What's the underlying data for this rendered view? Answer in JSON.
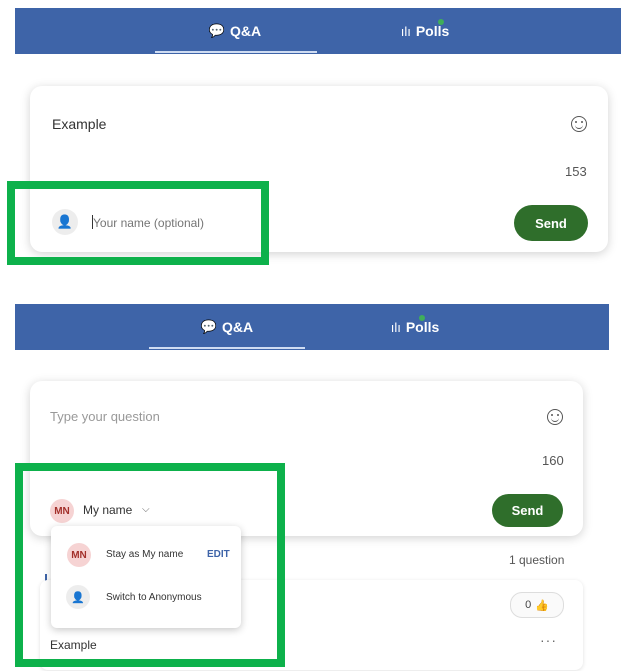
{
  "panel1": {
    "tabs": [
      {
        "label": "Q&A",
        "icon": "chat-bubbles-icon"
      },
      {
        "label": "Polls",
        "icon": "bar-chart-icon"
      }
    ],
    "question_text": "Example",
    "char_counter": "153",
    "name_placeholder": "Your name (optional)",
    "send_label": "Send"
  },
  "panel2": {
    "tabs": [
      {
        "label": "Q&A",
        "icon": "chat-bubbles-icon"
      },
      {
        "label": "Polls",
        "icon": "bar-chart-icon"
      }
    ],
    "question_placeholder": "Type your question",
    "char_counter": "160",
    "identity": {
      "initials": "MN",
      "label": "My name"
    },
    "send_label": "Send",
    "dropdown": {
      "stay_label": "Stay as My name",
      "edit_label": "EDIT",
      "anon_label": "Switch to Anonymous"
    },
    "question_count": "1 question",
    "question_item": {
      "text": "Example",
      "likes": "0"
    }
  },
  "colors": {
    "header_blue": "#3e64a8",
    "send_green": "#2f6e2b",
    "highlight_green": "#0db14b",
    "poll_dot": "#3fae5a"
  }
}
